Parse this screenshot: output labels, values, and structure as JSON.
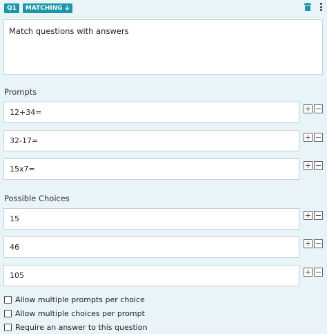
{
  "header": {
    "question_number": "Q1",
    "question_type": "MATCHING"
  },
  "icons": {
    "type_dropdown": "arrow-down-icon",
    "delete": "trash-icon",
    "menu": "kebab-menu-icon"
  },
  "question_text": "Match questions with answers",
  "prompts_label": "Prompts",
  "prompts": [
    "12+34=",
    "32-17=",
    "15x7="
  ],
  "choices_label": "Possible Choices",
  "choices": [
    "15",
    "46",
    "105"
  ],
  "options": [
    {
      "label": "Allow multiple prompts per choice",
      "checked": false
    },
    {
      "label": "Allow multiple choices per prompt",
      "checked": false
    },
    {
      "label": "Require an answer to this question",
      "checked": false
    }
  ],
  "colors": {
    "accent": "#1a96a8",
    "background": "#e9f4f8"
  }
}
